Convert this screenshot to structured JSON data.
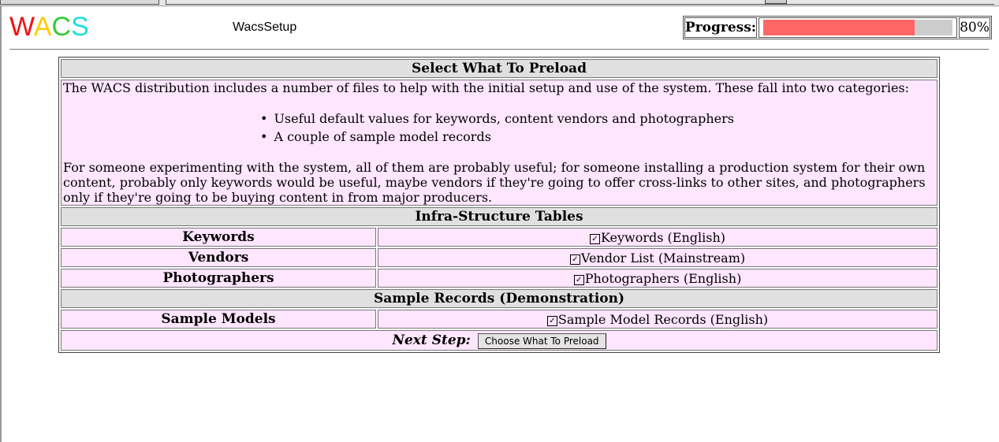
{
  "header": {
    "logo": [
      {
        "ch": "W",
        "color": "#ee1111"
      },
      {
        "ch": "A",
        "color": "#ffcc00"
      },
      {
        "ch": "C",
        "color": "#33cc33"
      },
      {
        "ch": "S",
        "color": "#22dddd"
      }
    ],
    "app_name": "WacsSetup",
    "progress": {
      "label": "Progress:",
      "percent_text": "80%",
      "value": 0.8,
      "fill_color": "#ff6666",
      "track_color": "#cccccc"
    }
  },
  "main": {
    "section1_title": "Select What To Preload",
    "intro_p1": "The WACS distribution includes a number of files to help with the initial setup and use of the system. These fall into two categories:",
    "bullets": [
      "Useful default values for keywords, content vendors and photographers",
      "A couple of sample model records"
    ],
    "intro_p2": "For someone experimenting with the system, all of them are probably useful; for someone installing a production system for their own content, probably only keywords would be useful, maybe vendors if they're going to offer cross-links to other sites, and photographers only if they're going to be buying content in from major producers.",
    "section2_title": "Infra-Structure Tables",
    "infra_rows": [
      {
        "label": "Keywords",
        "option": "Keywords (English)",
        "checked": true
      },
      {
        "label": "Vendors",
        "option": "Vendor List (Mainstream)",
        "checked": true
      },
      {
        "label": "Photographers",
        "option": "Photographers (English)",
        "checked": true
      }
    ],
    "section3_title": "Sample Records (Demonstration)",
    "sample_rows": [
      {
        "label": "Sample Models",
        "option": "Sample Model Records (English)",
        "checked": true
      }
    ],
    "next_step_label": "Next Step:",
    "next_button": "Choose What To Preload"
  },
  "colors": {
    "section_bg": "#e0e0e0",
    "cell_bg": "#ffe6ff"
  }
}
